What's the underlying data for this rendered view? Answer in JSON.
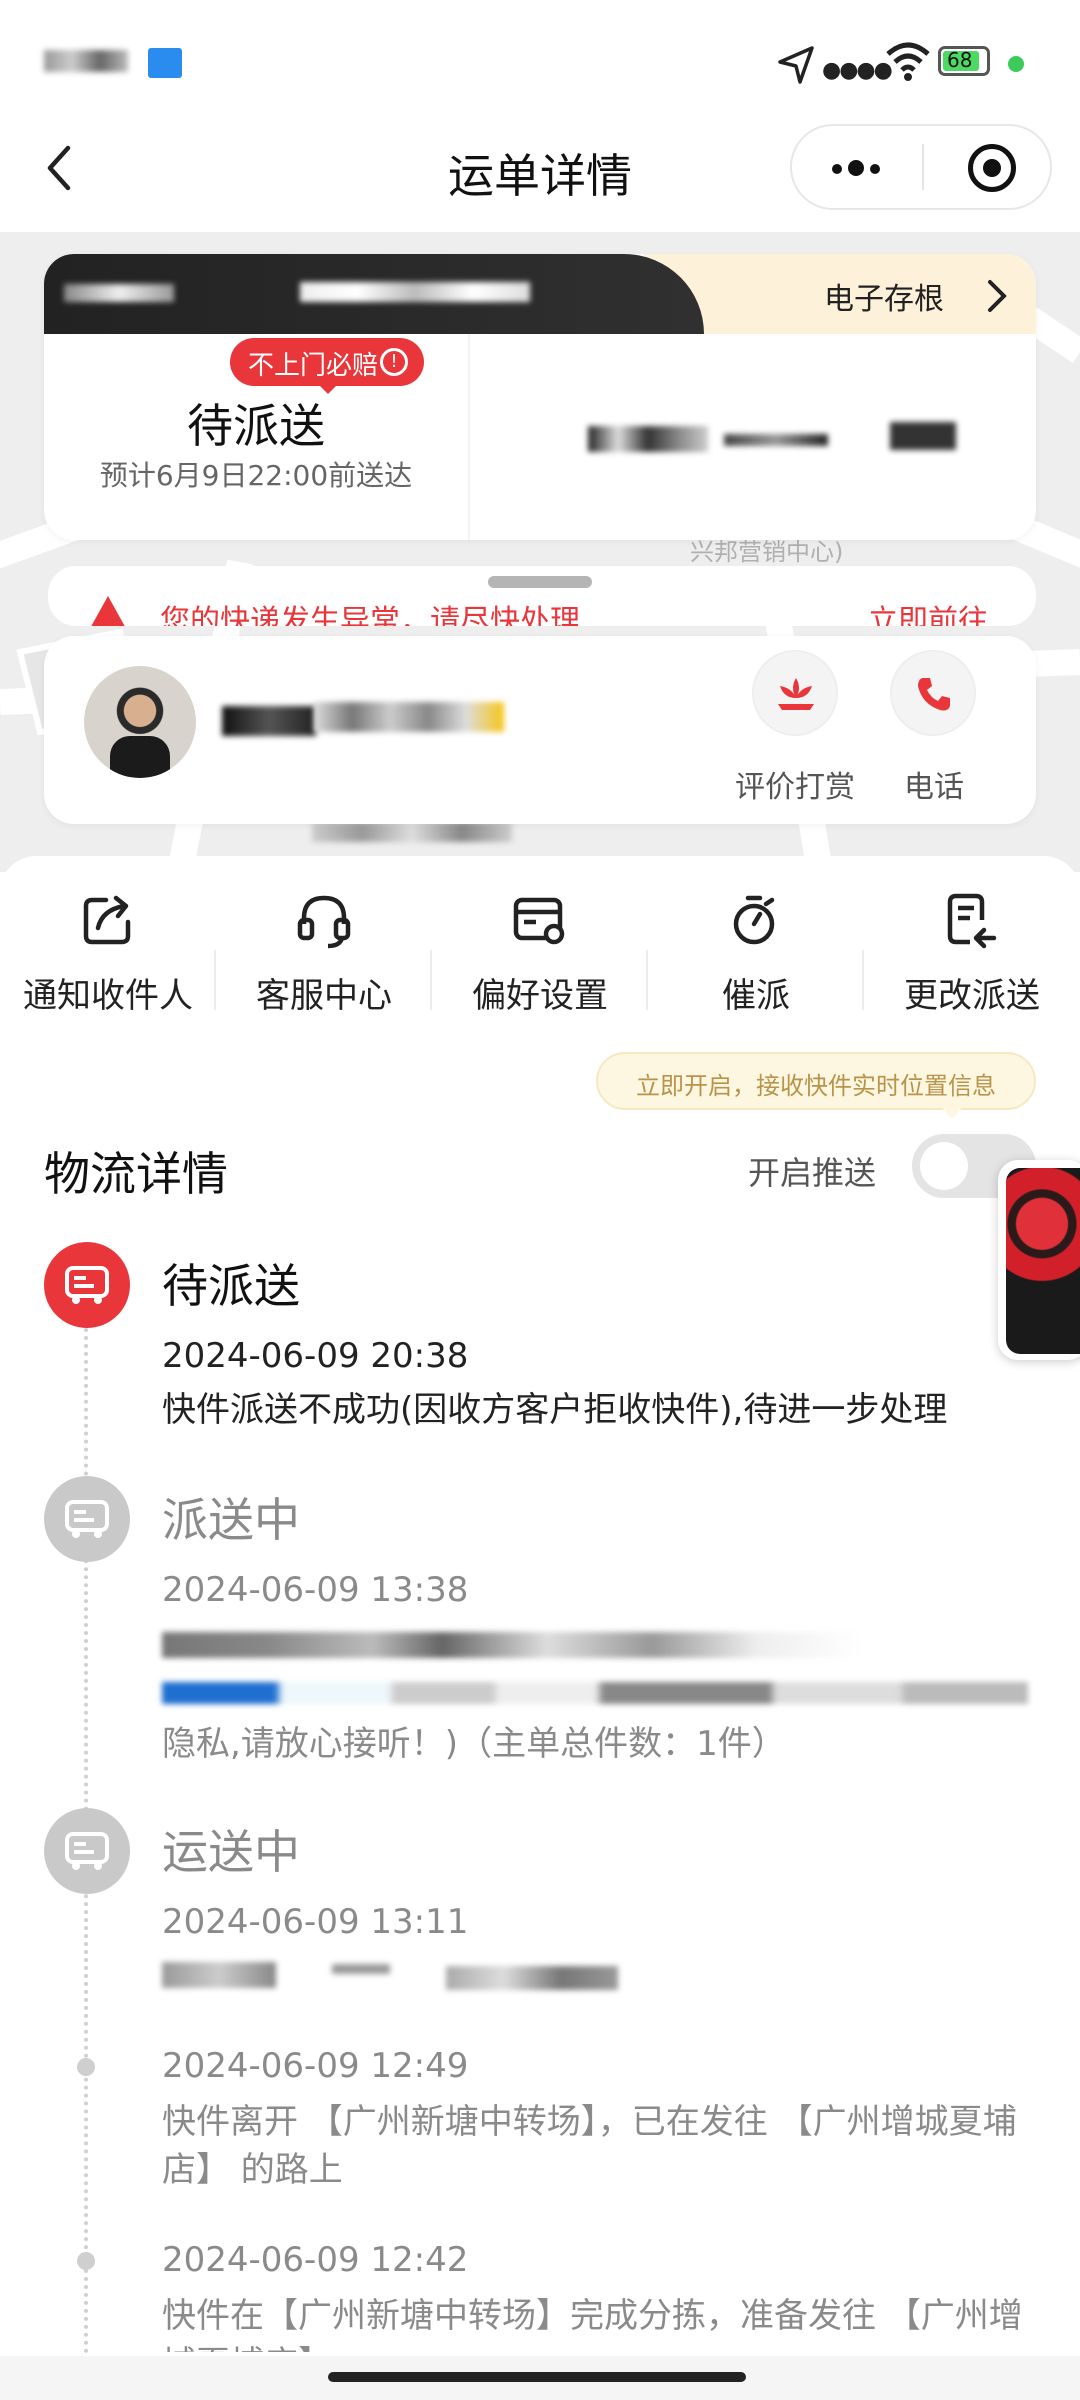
{
  "status_bar": {
    "battery": "68"
  },
  "nav": {
    "title": "运单详情"
  },
  "top_card": {
    "stub_label": "电子存根",
    "guarantee_badge": "不上门必赔",
    "status": "待派送",
    "eta": "预计6月9日22:00前送达",
    "map_label": "兴邦营销中心)"
  },
  "alert": {
    "text": "您的快递发生异常，请尽快处理",
    "action": "立即前往"
  },
  "courier": {
    "rate_label": "评价打赏",
    "phone_label": "电话"
  },
  "actions": [
    {
      "label": "通知收件人",
      "icon": "share-icon"
    },
    {
      "label": "客服中心",
      "icon": "headset-icon"
    },
    {
      "label": "偏好设置",
      "icon": "settings-card-icon"
    },
    {
      "label": "催派",
      "icon": "stopwatch-icon"
    },
    {
      "label": "更改派送",
      "icon": "edit-return-icon"
    }
  ],
  "push_tip": "立即开启，接收快件实时位置信息",
  "logistics": {
    "title": "物流详情",
    "push_label": "开启推送",
    "events": [
      {
        "status": "待派送",
        "time": "2024-06-09 20:38",
        "text": "快件派送不成功(因收方客户拒收快件),待进一步处理"
      },
      {
        "status": "派送中",
        "time": "2024-06-09 13:38",
        "text": "隐私,请放心接听！)（主单总件数：1件）"
      },
      {
        "status": "运送中",
        "time": "2024-06-09 13:11",
        "text": ""
      },
      {
        "status": "",
        "time": "2024-06-09 12:49",
        "text": "快件离开 【广州新塘中转场】，已在发往 【广州增城夏埔店】 的路上"
      },
      {
        "status": "",
        "time": "2024-06-09 12:42",
        "text": "快件在【广州新塘中转场】完成分拣，准备发往 【广州增城夏埔店】"
      }
    ]
  },
  "colors": {
    "accent_red": "#e8363a",
    "cream": "#fdf1da",
    "gray_icon": "#c9c9c9"
  }
}
